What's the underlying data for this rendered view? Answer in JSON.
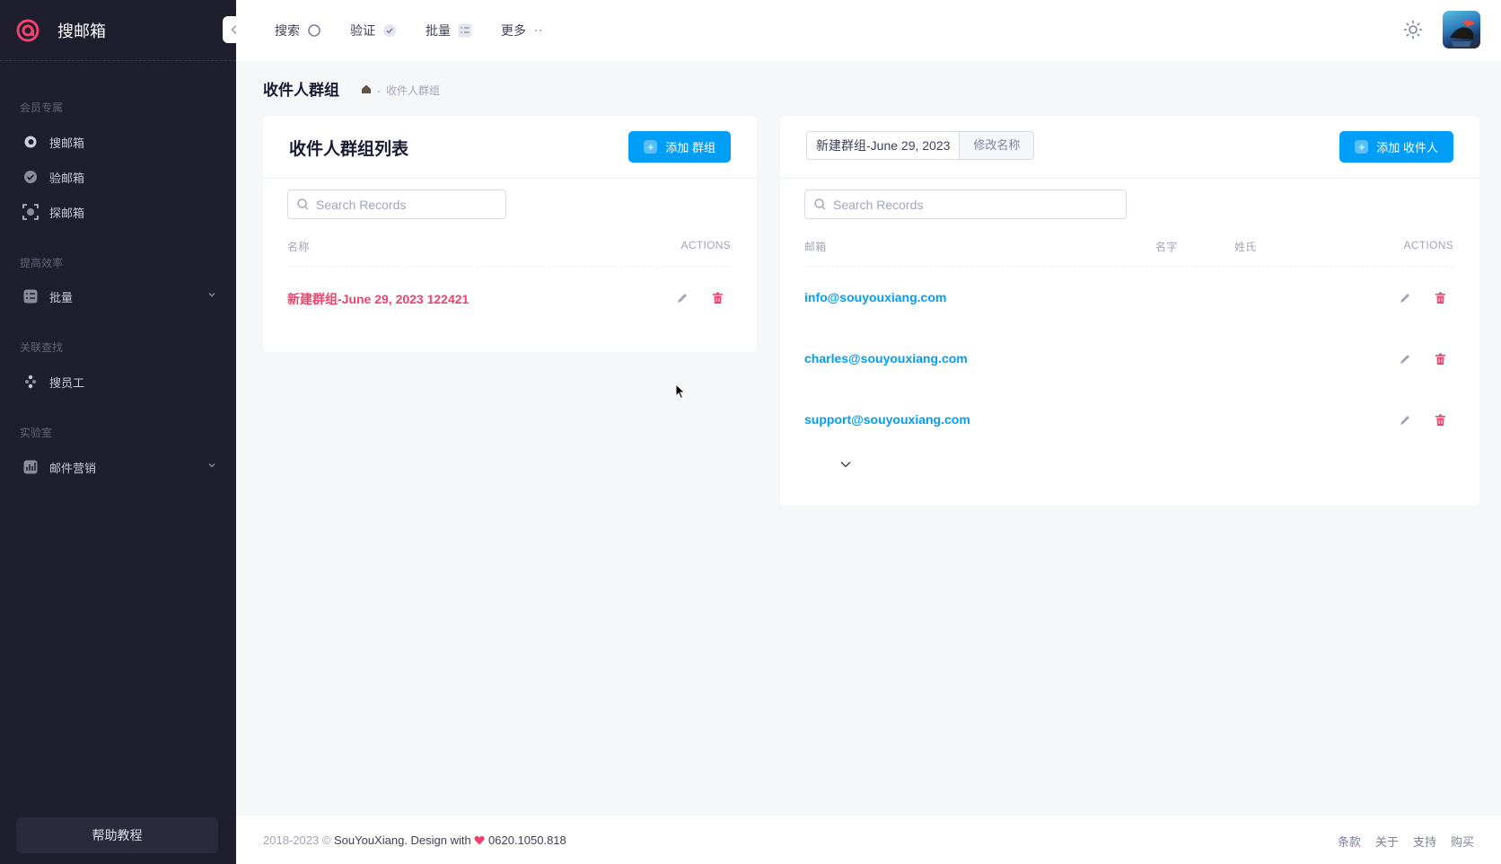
{
  "app": {
    "name": "搜邮箱",
    "brand_color": "#f1416c"
  },
  "sidebar": {
    "sections": [
      {
        "title": "会员专属",
        "items": [
          {
            "label": "搜邮箱",
            "icon": "search-mail-icon"
          },
          {
            "label": "验邮箱",
            "icon": "check-circle-icon"
          },
          {
            "label": "探邮箱",
            "icon": "scan-icon"
          }
        ]
      },
      {
        "title": "提高效率",
        "items": [
          {
            "label": "批量",
            "icon": "list-check-icon",
            "expandable": true
          }
        ]
      },
      {
        "title": "关联查找",
        "items": [
          {
            "label": "搜员工",
            "icon": "people-icon"
          }
        ]
      },
      {
        "title": "实验室",
        "items": [
          {
            "label": "邮件营销",
            "icon": "chart-icon",
            "expandable": true
          }
        ]
      }
    ],
    "help_label": "帮助教程"
  },
  "topnav": {
    "items": [
      {
        "label": "搜索",
        "icon": "circle-search-icon"
      },
      {
        "label": "验证",
        "icon": "check-badge-icon"
      },
      {
        "label": "批量",
        "icon": "list-icon"
      },
      {
        "label": "更多",
        "icon": "dots-icon"
      }
    ]
  },
  "page": {
    "title": "收件人群组",
    "breadcrumb": {
      "separator": "-",
      "current": "收件人群组"
    }
  },
  "left_card": {
    "title": "收件人群组列表",
    "add_button": "添加 群组",
    "search_placeholder": "Search Records",
    "columns": {
      "name": "名称",
      "actions": "ACTIONS"
    },
    "rows": [
      {
        "name": "新建群组-June 29, 2023 122421"
      }
    ]
  },
  "right_card": {
    "group_name_value": "新建群组-June 29, 2023",
    "rename_button": "修改名称",
    "add_button": "添加 收件人",
    "search_placeholder": "Search Records",
    "columns": {
      "email": "邮箱",
      "first_name": "名字",
      "last_name": "姓氏",
      "actions": "ACTIONS"
    },
    "rows": [
      {
        "email": "info@souyouxiang.com"
      },
      {
        "email": "charles@souyouxiang.com"
      },
      {
        "email": "support@souyouxiang.com"
      }
    ]
  },
  "footer": {
    "copyright_prefix": "2018-2023 ©",
    "brand": "SouYouXiang.",
    "design_with": "Design with",
    "phone": "0620.1050.818",
    "links": [
      "条款",
      "关于",
      "支持",
      "购买"
    ]
  },
  "colors": {
    "primary": "#009ef7",
    "danger": "#f1416c",
    "link": "#009ef7",
    "sidebar_bg": "#1e1e2d"
  }
}
